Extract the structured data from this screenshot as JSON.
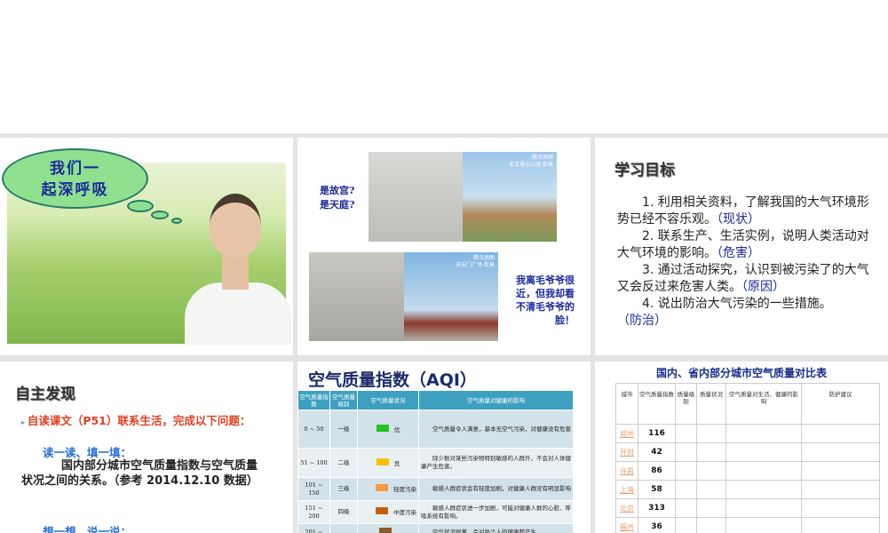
{
  "slide1": {
    "bubble_line1": "我们一",
    "bubble_line2": "起深呼吸"
  },
  "slide2": {
    "q1": "是故宫?",
    "q2": "是天庭?",
    "cap1_title": "腾讯地图",
    "cap1_sub": "北京景山公园 街景",
    "cap2_title": "腾讯地图",
    "cap2_sub": "天安门广场 街景",
    "remark": "我离毛爷爷很近，但我却看不清毛爷爷的脸！"
  },
  "slide3": {
    "title": "学习目标",
    "goals": [
      {
        "text": "1. 利用相关资料，了解我国的大气环境形势已经不容乐观。",
        "tag": "（现状）"
      },
      {
        "text": "2. 联系生产、生活实例，说明人类活动对大气环境的影响。",
        "tag": "（危害）"
      },
      {
        "text": "3. 通过活动探究，认识到被污染了的大气又会反过来危害人类。",
        "tag": "（原因）"
      },
      {
        "text": "4. 说出防治大气污染的一些措施。",
        "tag": "（防治）"
      }
    ]
  },
  "slide4": {
    "title": "自主发现",
    "bullet": "自读课文（P51）联系生活，完成以下问题：",
    "sub1": "读一读、填一填：",
    "body": "国内部分城市空气质量指数与空气质量状况之间的关系。（参考 2014.12.10 数据）",
    "sub2": "想一想、说一说："
  },
  "slide5": {
    "title": "空气质量指数（AQI）",
    "headers": [
      "空气质量指数",
      "空气质量级别",
      "空气质量状况",
      "空气质量对健康的影响"
    ],
    "rows": [
      {
        "range": "0 ~ 50",
        "level": "一级",
        "status": "优",
        "color": "#22c422",
        "effect": "空气质量令人满意，基本无空气污染，对健康没有危害"
      },
      {
        "range": "51 ~ 100",
        "level": "二级",
        "status": "良",
        "color": "#f5c000",
        "effect": "除少数对某些污染物特别敏感的人群外，不会对人体健康产生危害。"
      },
      {
        "range": "101 ~ 150",
        "level": "三级",
        "status": "轻度污染",
        "color": "#f59a40",
        "effect": "敏感人群症状会有轻度加剧，对健康人群没有明显影响"
      },
      {
        "range": "151 ~ 200",
        "level": "四级",
        "status": "中度污染",
        "color": "#c86010",
        "effect": "敏感人群症状进一步加剧，可能对健康人群的心脏、呼吸系统有影响。"
      },
      {
        "range": "201 ~",
        "level": "",
        "status": "",
        "color": "#8a5a2a",
        "effect": "空气状况很差，会对每个人的健康都产生"
      }
    ]
  },
  "slide6": {
    "title": "国内、省内部分城市空气质量对比表",
    "headers": [
      "城市",
      "空气质量指数",
      "质量级别",
      "质量状况",
      "空气质量对生活、健康的影响",
      "防护建议"
    ],
    "rows": [
      {
        "city": "郑州",
        "aqi": "116"
      },
      {
        "city": "开封",
        "aqi": "42"
      },
      {
        "city": "许昌",
        "aqi": "86"
      },
      {
        "city": "上海",
        "aqi": "58"
      },
      {
        "city": "北京",
        "aqi": "313"
      },
      {
        "city": "福州",
        "aqi": "36"
      }
    ]
  }
}
